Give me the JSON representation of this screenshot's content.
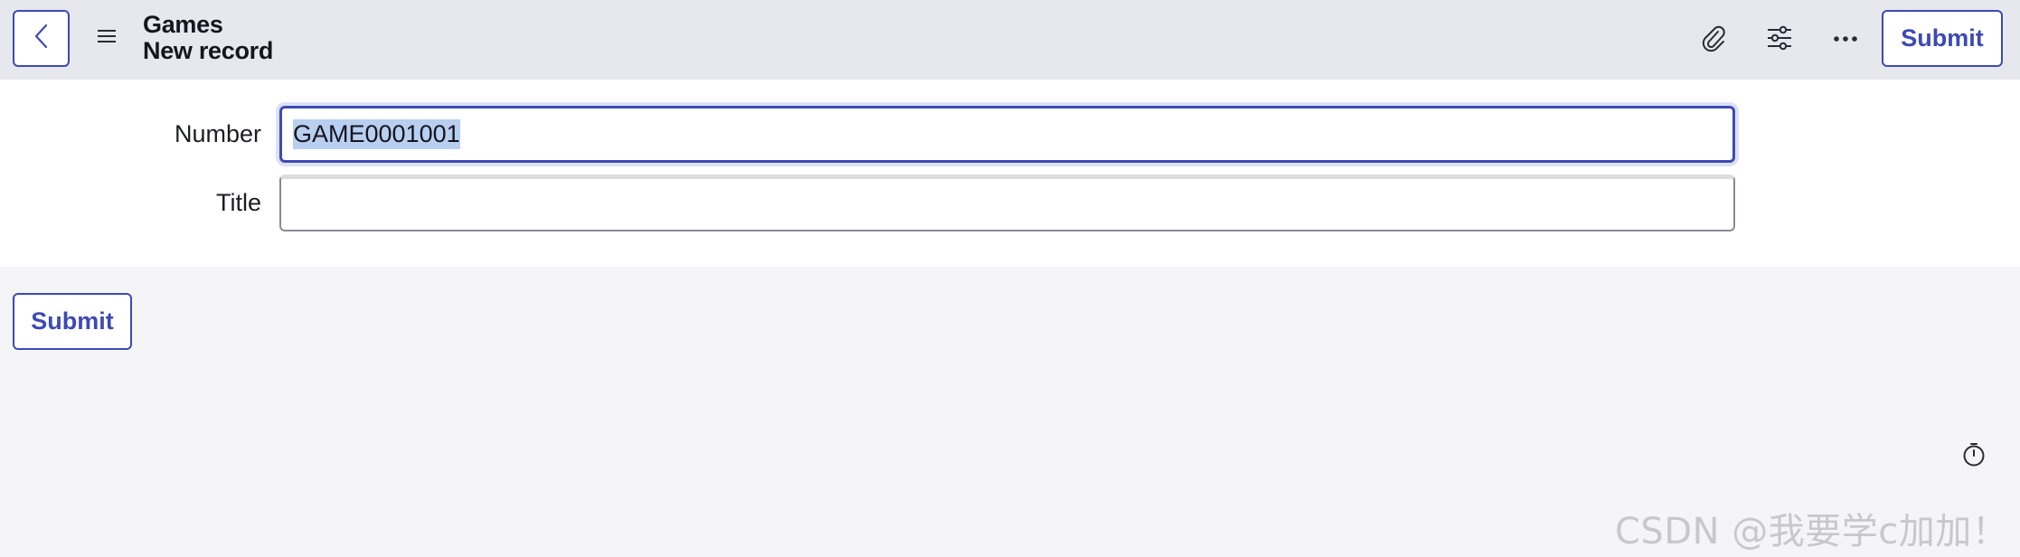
{
  "header": {
    "table_name": "Games",
    "record_title": "New record",
    "back_icon": "chevron-left-icon",
    "menu_icon": "hamburger-menu-icon",
    "attachment_icon": "paperclip-icon",
    "personalize_icon": "sliders-icon",
    "more_icon": "ellipsis-icon",
    "submit_label": "Submit",
    "accent_color": "#3d4ab4"
  },
  "form": {
    "fields": [
      {
        "label": "Number",
        "value": "GAME0001001",
        "focused": true,
        "text_selected": true
      },
      {
        "label": "Title",
        "value": ""
      }
    ]
  },
  "footer": {
    "submit_label": "Submit",
    "timer_icon": "stopwatch-icon"
  },
  "watermark": {
    "text": "CSDN @我要学c加加！"
  }
}
